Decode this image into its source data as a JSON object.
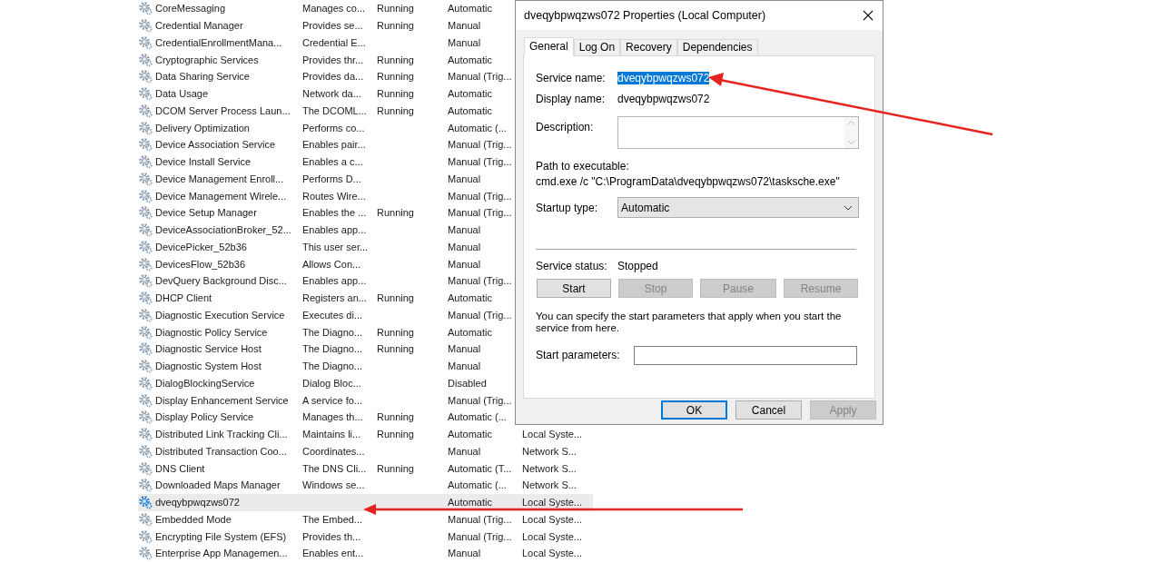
{
  "services": {
    "rows": [
      {
        "name": "CoreMessaging",
        "description": "Manages co...",
        "status": "Running",
        "startup_type": "Automatic",
        "selected": false
      },
      {
        "name": "Credential Manager",
        "description": "Provides se...",
        "status": "Running",
        "startup_type": "Manual",
        "selected": false
      },
      {
        "name": "CredentialEnrollmentMana...",
        "description": "Credential E...",
        "startup_type": "Manual",
        "selected": false
      },
      {
        "name": "Cryptographic Services",
        "description": "Provides thr...",
        "status": "Running",
        "startup_type": "Automatic",
        "selected": false
      },
      {
        "name": "Data Sharing Service",
        "description": "Provides da...",
        "status": "Running",
        "startup_type": "Manual (Trig...",
        "selected": false
      },
      {
        "name": "Data Usage",
        "description": "Network da...",
        "status": "Running",
        "startup_type": "Automatic",
        "selected": false
      },
      {
        "name": "DCOM Server Process Laun...",
        "description": "The DCOML...",
        "status": "Running",
        "startup_type": "Automatic",
        "selected": false
      },
      {
        "name": "Delivery Optimization",
        "description": "Performs co...",
        "startup_type": "Automatic (...",
        "selected": false
      },
      {
        "name": "Device Association Service",
        "description": "Enables pair...",
        "startup_type": "Manual (Trig...",
        "selected": false
      },
      {
        "name": "Device Install Service",
        "description": "Enables a c...",
        "startup_type": "Manual (Trig...",
        "selected": false
      },
      {
        "name": "Device Management Enroll...",
        "description": "Performs D...",
        "startup_type": "Manual",
        "selected": false
      },
      {
        "name": "Device Management Wirele...",
        "description": "Routes Wire...",
        "startup_type": "Manual (Trig...",
        "selected": false
      },
      {
        "name": "Device Setup Manager",
        "description": "Enables the ...",
        "status": "Running",
        "startup_type": "Manual (Trig...",
        "selected": false
      },
      {
        "name": "DeviceAssociationBroker_52...",
        "description": "Enables app...",
        "startup_type": "Manual",
        "selected": false
      },
      {
        "name": "DevicePicker_52b36",
        "description": "This user ser...",
        "startup_type": "Manual",
        "selected": false
      },
      {
        "name": "DevicesFlow_52b36",
        "description": "Allows Con...",
        "startup_type": "Manual",
        "selected": false
      },
      {
        "name": "DevQuery Background Disc...",
        "description": "Enables app...",
        "startup_type": "Manual (Trig...",
        "selected": false
      },
      {
        "name": "DHCP Client",
        "description": "Registers an...",
        "status": "Running",
        "startup_type": "Automatic",
        "selected": false
      },
      {
        "name": "Diagnostic Execution Service",
        "description": "Executes di...",
        "startup_type": "Manual (Trig...",
        "selected": false
      },
      {
        "name": "Diagnostic Policy Service",
        "description": "The Diagno...",
        "status": "Running",
        "startup_type": "Automatic",
        "selected": false
      },
      {
        "name": "Diagnostic Service Host",
        "description": "The Diagno...",
        "status": "Running",
        "startup_type": "Manual",
        "selected": false
      },
      {
        "name": "Diagnostic System Host",
        "description": "The Diagno...",
        "startup_type": "Manual",
        "selected": false
      },
      {
        "name": "DialogBlockingService",
        "description": "Dialog Bloc...",
        "startup_type": "Disabled",
        "selected": false
      },
      {
        "name": "Display Enhancement Service",
        "description": "A service fo...",
        "startup_type": "Manual (Trig...",
        "selected": false
      },
      {
        "name": "Display Policy Service",
        "description": "Manages th...",
        "status": "Running",
        "startup_type": "Automatic (...",
        "selected": false
      },
      {
        "name": "Distributed Link Tracking Cli...",
        "description": "Maintains li...",
        "status": "Running",
        "startup_type": "Automatic",
        "log_on_as": "Local Syste...",
        "selected": false
      },
      {
        "name": "Distributed Transaction Coo...",
        "description": "Coordinates...",
        "startup_type": "Manual",
        "log_on_as": "Network S...",
        "selected": false
      },
      {
        "name": "DNS Client",
        "description": "The DNS Cli...",
        "status": "Running",
        "startup_type": "Automatic (T...",
        "log_on_as": "Network S...",
        "selected": false
      },
      {
        "name": "Downloaded Maps Manager",
        "description": "Windows se...",
        "startup_type": "Automatic (...",
        "log_on_as": "Network S...",
        "selected": false
      },
      {
        "name": "dveqybpwqzws072",
        "startup_type": "Automatic",
        "log_on_as": "Local Syste...",
        "selected": true
      },
      {
        "name": "Embedded Mode",
        "description": "The Embed...",
        "startup_type": "Manual (Trig...",
        "log_on_as": "Local Syste...",
        "selected": false
      },
      {
        "name": "Encrypting File System (EFS)",
        "description": "Provides th...",
        "startup_type": "Manual (Trig...",
        "log_on_as": "Local Syste...",
        "selected": false
      },
      {
        "name": "Enterprise App Managemen...",
        "description": "Enables ent...",
        "startup_type": "Manual",
        "log_on_as": "Local Syste...",
        "selected": false
      }
    ]
  },
  "dialog": {
    "title": "dveqybpwqzws072 Properties (Local Computer)",
    "tabs": [
      {
        "label": "General",
        "selected": true
      },
      {
        "label": "Log On",
        "selected": false
      },
      {
        "label": "Recovery",
        "selected": false
      },
      {
        "label": "Dependencies",
        "selected": false
      }
    ],
    "service_name": {
      "label": "Service name:",
      "value": "dveqybpwqzws072",
      "selected": true
    },
    "display_name": {
      "label": "Display name:",
      "value": "dveqybpwqzws072"
    },
    "description": {
      "label": "Description:"
    },
    "path": {
      "label": "Path to executable:",
      "value": "cmd.exe /c \"C:\\ProgramData\\dveqybpwqzws072\\tasksche.exe\""
    },
    "startup_type": {
      "label": "Startup type:",
      "value": "Automatic"
    },
    "service_status": {
      "label": "Service status:",
      "value": "Stopped"
    },
    "control_buttons": [
      {
        "label": "Start",
        "disabled": false
      },
      {
        "label": "Stop",
        "disabled": true
      },
      {
        "label": "Pause",
        "disabled": true
      },
      {
        "label": "Resume",
        "disabled": true
      }
    ],
    "hint": "You can specify the start parameters that apply when you start the service from here.",
    "start_parameters": {
      "label": "Start parameters:"
    },
    "footer_buttons": [
      {
        "label": "OK",
        "disabled": false,
        "focused": true
      },
      {
        "label": "Cancel",
        "disabled": false,
        "focused": false
      },
      {
        "label": "Apply",
        "disabled": true,
        "focused": false
      }
    ]
  }
}
